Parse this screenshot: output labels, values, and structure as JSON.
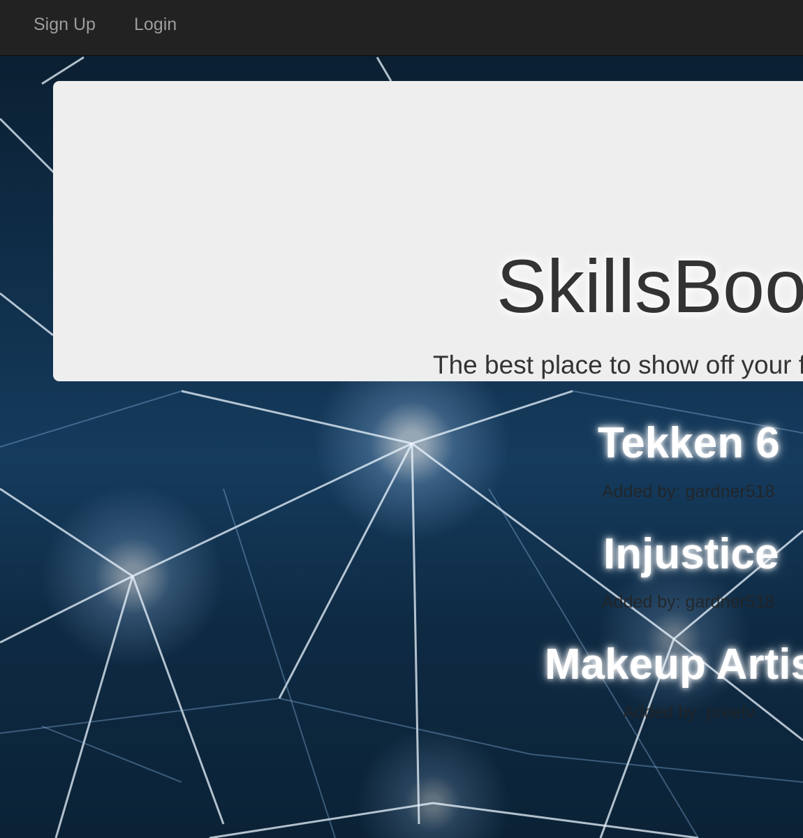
{
  "navbar": {
    "links": [
      {
        "label": "Sign Up"
      },
      {
        "label": "Login"
      }
    ]
  },
  "jumbotron": {
    "title": "SkillsBoo",
    "subtitle": "The best place to show off your f"
  },
  "skills": [
    {
      "title": "Tekken 6",
      "added_by": "Added by: gardner518"
    },
    {
      "title": "Injustice",
      "added_by": "Added by: gardner518"
    },
    {
      "title": "Makeup Artis",
      "added_by": "Added by: preetv"
    }
  ],
  "colors": {
    "navbar_bg": "#222222",
    "nav_link": "#9d9d9d",
    "jumbotron_bg": "#eeeeee",
    "heading_text": "#333333",
    "skill_title": "#ffffff"
  }
}
